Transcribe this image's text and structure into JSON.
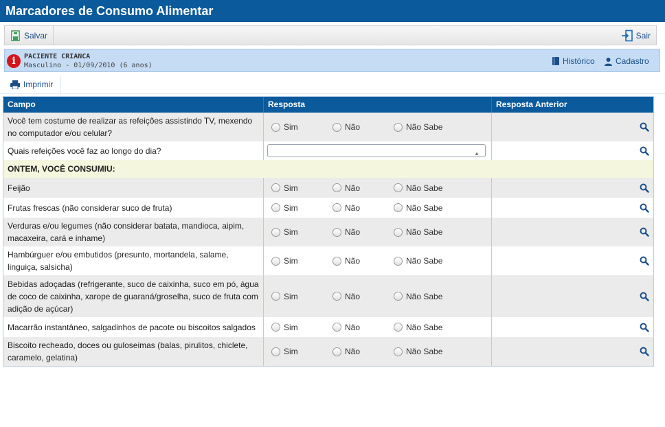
{
  "app": {
    "title": "Marcadores de Consumo Alimentar"
  },
  "toolbar": {
    "save_label": "Salvar",
    "exit_label": "Sair"
  },
  "patient": {
    "name": "PACIENTE CRIANCA",
    "details": "Masculino - 01/09/2010 (6 anos)",
    "history_label": "Histórico",
    "register_label": "Cadastro"
  },
  "print_label": "Imprimir",
  "table": {
    "headers": [
      "Campo",
      "Resposta",
      "Resposta Anterior"
    ],
    "options": [
      "Sim",
      "Não",
      "Não Sabe"
    ],
    "rows": [
      {
        "question": "Você tem costume de realizar as refeições assistindo TV, mexendo no computador e/ou celular?"
      },
      {
        "question": "Quais refeições você faz ao longo do dia?",
        "select_value": ""
      },
      {
        "section": "ONTEM, VOCÊ CONSUMIU:"
      },
      {
        "question": "Feijão"
      },
      {
        "question": "Frutas frescas (não considerar suco de fruta)"
      },
      {
        "question": "Verduras e/ou legumes (não considerar batata, mandioca, aipim, macaxeira, cará e inhame)"
      },
      {
        "question": "Hambúrguer e/ou embutidos (presunto, mortandela, salame, linguiça, salsicha)"
      },
      {
        "question": "Bebidas adoçadas (refrigerante, suco de caixinha, suco em pó, água de coco de caixinha, xarope de guaraná/groselha, suco de fruta com adição de açúcar)"
      },
      {
        "question": "Macarrão instantâneo, salgadinhos de pacote ou biscoitos salgados"
      },
      {
        "question": "Biscoito recheado, doces ou guloseimas (balas, pirulitos, chiclete, caramelo, gelatina)"
      }
    ]
  },
  "colors": {
    "header_blue": "#0a5a9c",
    "patient_bar": "#c5dcf4",
    "section_bg": "#f5f6de",
    "alert_red": "#d4161b"
  }
}
